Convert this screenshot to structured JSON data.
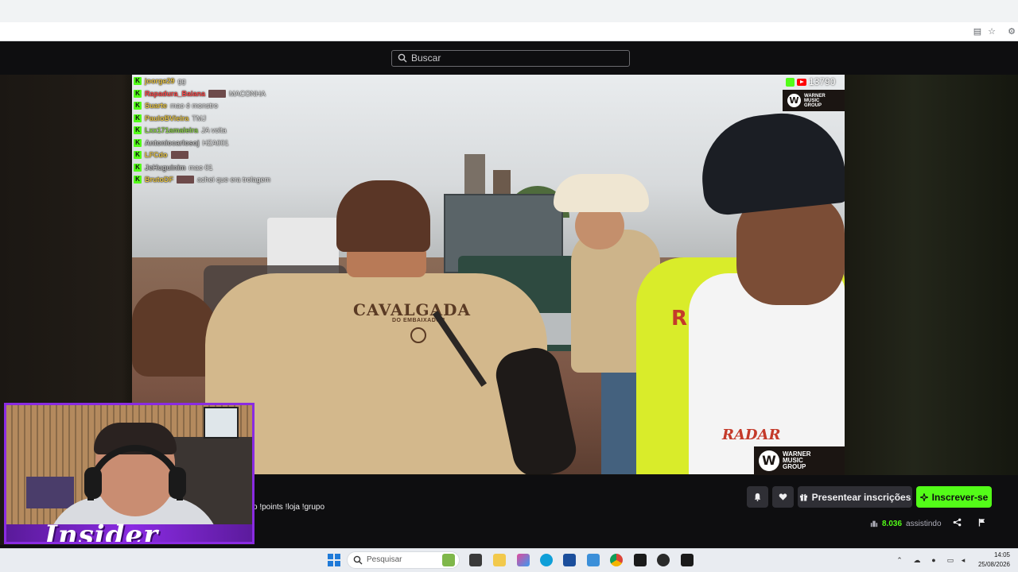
{
  "search": {
    "placeholder": "Buscar"
  },
  "chat": [
    {
      "user": "joorge29",
      "color": "#e9c648",
      "emote": false,
      "message": "gg"
    },
    {
      "user": "Rapadura_Baiana",
      "color": "#ff4b4b",
      "emote": true,
      "message": "MACONHA"
    },
    {
      "user": "Suarte",
      "color": "#e9c648",
      "emote": false,
      "message": "mao é monstro"
    },
    {
      "user": "PauloBVieira",
      "color": "#e9c648",
      "emote": false,
      "message": "TMJ"
    },
    {
      "user": "Lxx171amaleira",
      "color": "#8fd14f",
      "emote": false,
      "message": "JA volta"
    },
    {
      "user": "Antoniocarlosoj",
      "color": "#bdbdbd",
      "emote": false,
      "message": "HZA001"
    },
    {
      "user": "LFCdo",
      "color": "#e9c648",
      "emote": true,
      "message": ""
    },
    {
      "user": "JeHuguinim",
      "color": "#bdbdbd",
      "emote": false,
      "message": "mao 01"
    },
    {
      "user": "BrutoDF",
      "color": "#e9c648",
      "emote": true,
      "message": "achei que era trolagem"
    }
  ],
  "stream": {
    "viewer_count": "13790",
    "watermark_line1": "WARNER\nMUSIC\nGROUP",
    "shirt_text": "CAVALGADA",
    "shirt_subtext": "DO EMBAIXADOR",
    "vest_text": "RADAR"
  },
  "webcam": {
    "logo": "Insider"
  },
  "info": {
    "commands": "o !points !loja !grupo",
    "gift_label": "Presentear inscrições",
    "subscribe_label": "Inscrever-se",
    "watchers_count": "8.036",
    "watchers_label": "assistindo"
  },
  "taskbar": {
    "search_label": "Pesquisar",
    "time": "14:05",
    "date": "25/08/2026"
  },
  "colors": {
    "accent": "#53fc18",
    "webcam_frame": "#8a2be2",
    "background": "#0e0e10"
  }
}
